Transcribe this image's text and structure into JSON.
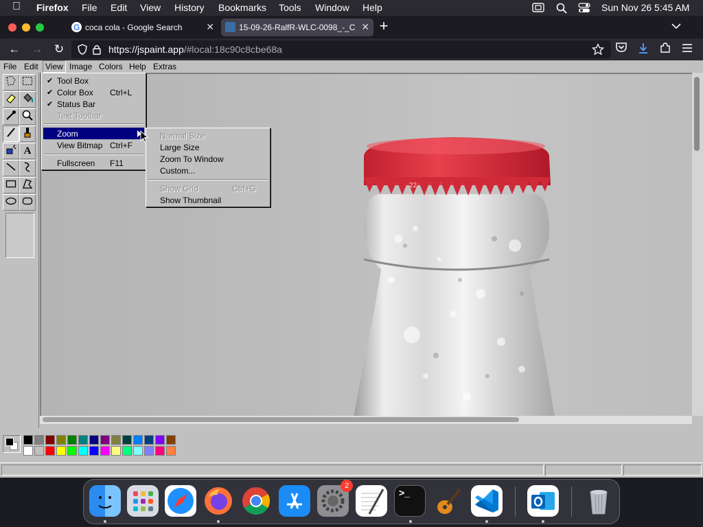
{
  "mac_menubar": {
    "app": "Firefox",
    "items": [
      "File",
      "Edit",
      "View",
      "History",
      "Bookmarks",
      "Tools",
      "Window",
      "Help"
    ],
    "clock": "Sun Nov 26  5:45 AM"
  },
  "browser": {
    "tabs": [
      {
        "title": "coca cola - Google Search"
      },
      {
        "title": "15-09-26-RalfR-WLC-0098_-_C"
      }
    ],
    "url": {
      "host": "https://jspaint.app",
      "path": "/#local:18c90c8cbe68a"
    }
  },
  "jspaint": {
    "menus": [
      "File",
      "Edit",
      "View",
      "Image",
      "Colors",
      "Help",
      "Extras"
    ],
    "view_menu": [
      {
        "label": "Tool Box",
        "checked": true,
        "shortcut": ""
      },
      {
        "label": "Color Box",
        "checked": true,
        "shortcut": "Ctrl+L"
      },
      {
        "label": "Status Bar",
        "checked": true,
        "shortcut": ""
      },
      {
        "label": "Text Toolbar",
        "checked": false,
        "shortcut": "",
        "disabled": true
      },
      {
        "label": "Zoom",
        "highlighted": true,
        "submenu": true
      },
      {
        "label": "View Bitmap",
        "shortcut": "Ctrl+F"
      },
      {
        "label": "Fullscreen",
        "shortcut": "F11"
      }
    ],
    "zoom_menu": [
      {
        "label": "Normal Size",
        "disabled": true
      },
      {
        "label": "Large Size"
      },
      {
        "label": "Zoom To Window"
      },
      {
        "label": "Custom..."
      },
      {
        "label": "Show Grid",
        "shortcut": "Ctrl+G",
        "disabled": true
      },
      {
        "label": "Show Thumbnail"
      }
    ],
    "cap_text": "22",
    "palette_top": [
      "#000000",
      "#808080",
      "#800000",
      "#808000",
      "#008000",
      "#008080",
      "#000080",
      "#800080",
      "#808040",
      "#004040",
      "#0080ff",
      "#004080",
      "#8000ff",
      "#804000"
    ],
    "palette_bottom": [
      "#ffffff",
      "#c0c0c0",
      "#ff0000",
      "#ffff00",
      "#00ff00",
      "#00ffff",
      "#0000ff",
      "#ff00ff",
      "#ffff80",
      "#00ff80",
      "#80ffff",
      "#8080ff",
      "#ff0080",
      "#ff8040"
    ]
  },
  "dock": {
    "badge": "2"
  }
}
